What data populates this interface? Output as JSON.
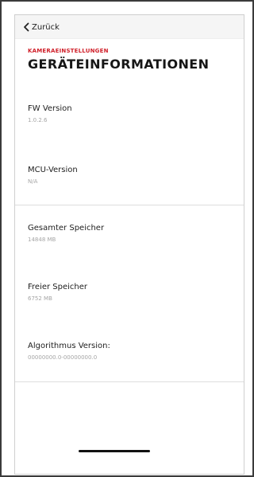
{
  "nav": {
    "back_label": "Zurück",
    "back_icon": "chevron-left-icon"
  },
  "header": {
    "overline": "KAMERAEINSTELLUNGEN",
    "title": "GERÄTEINFORMATIONEN"
  },
  "info": [
    {
      "label": "FW Version",
      "value": "1.0.2.6"
    },
    {
      "label": "MCU-Version",
      "value": "N/A"
    },
    {
      "label": "Gesamter Speicher",
      "value": "14848 MB"
    },
    {
      "label": "Freier Speicher",
      "value": "6752 MB"
    },
    {
      "label": "Algorithmus Version:",
      "value": "00000000.0-00000000.0"
    }
  ],
  "colors": {
    "accent": "#d0202a",
    "text": "#1e1e1e",
    "muted": "#a5a5a5"
  }
}
